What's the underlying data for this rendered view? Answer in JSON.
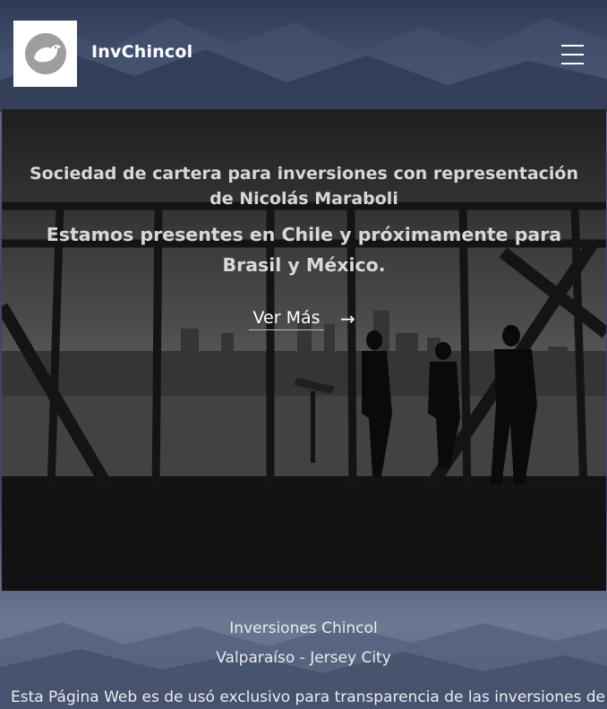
{
  "header": {
    "brand_name": "InvChincol",
    "logo_icon": "bird-icon",
    "menu_icon": "hamburger-menu-icon"
  },
  "hero": {
    "title": "Sociedad de cartera para inversiones con representación de Nicolás Maraboli",
    "subtitle": "Estamos presentes en Chile y próximamente para Brasil y México.",
    "cta_label": "Ver Más",
    "cta_arrow": "→"
  },
  "footer": {
    "line1": "Inversiones Chincol",
    "line2": "Valparaíso - Jersey City",
    "line3": "Esta Página Web es de usó exclusivo para transparencia de las inversiones de"
  },
  "colors": {
    "background": "#3b4763",
    "hero_text": "#d7d7d7",
    "white": "#ffffff"
  }
}
